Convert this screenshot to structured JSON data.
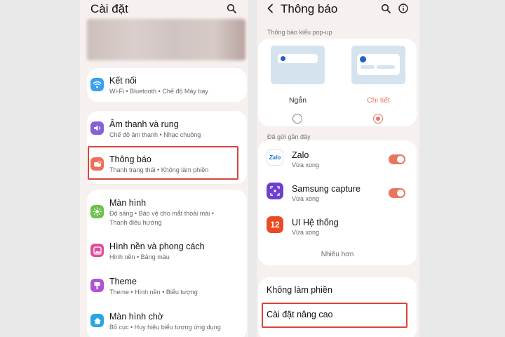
{
  "left": {
    "title": "Cài đặt",
    "groups": [
      {
        "items": [
          {
            "title": "Kết nối",
            "subtitle": "Wi-Fi  •  Bluetooth  •  Chế độ Máy bay",
            "icon": "wifi-icon"
          }
        ]
      },
      {
        "items": [
          {
            "title": "Âm thanh và rung",
            "subtitle": "Chế độ âm thanh  •  Nhạc chuông",
            "icon": "sound-icon"
          },
          {
            "title": "Thông báo",
            "subtitle": "Thanh trạng thái  •  Không làm phiền",
            "icon": "notification-icon"
          }
        ]
      },
      {
        "items": [
          {
            "title": "Màn hình",
            "subtitle": "Độ sáng  •  Bảo vệ cho mắt thoải mái  •",
            "subtitle2": "Thanh điều hướng",
            "icon": "display-icon"
          },
          {
            "title": "Hình nền và phong cách",
            "subtitle": "Hình nền  •  Bảng màu",
            "icon": "wallpaper-icon"
          },
          {
            "title": "Theme",
            "subtitle": "Theme  •  Hình nền  •  Biểu tượng",
            "icon": "theme-icon"
          },
          {
            "title": "Màn hình chờ",
            "subtitle": "Bố cục  •  Huy hiệu biểu tượng ứng dụng",
            "icon": "home-screen-icon"
          }
        ]
      }
    ]
  },
  "right": {
    "title": "Thông báo",
    "popup_section": "Thông báo kiểu pop-up",
    "popup_options": [
      {
        "label": "Ngắn",
        "selected": false
      },
      {
        "label": "Chi tiết",
        "selected": true
      }
    ],
    "recent_section": "Đã gửi gần đây",
    "apps": [
      {
        "name": "Zalo",
        "time": "Vừa xong",
        "enabled": true,
        "icon": "zalo-icon",
        "icon_text": "Zalo"
      },
      {
        "name": "Samsung capture",
        "time": "Vừa xong",
        "enabled": true,
        "icon": "samsung-capture-icon"
      },
      {
        "name": "UI Hệ thống",
        "time": "Vừa xong",
        "enabled": null,
        "icon": "system-ui-icon",
        "icon_text": "12"
      }
    ],
    "more": "Nhiều hơn",
    "dnd": "Không làm phiền",
    "advanced": "Cài đặt nâng cao"
  },
  "colors": {
    "accent": "#e8765f",
    "highlight": "#d9453d",
    "background": "#f6f0ef"
  }
}
